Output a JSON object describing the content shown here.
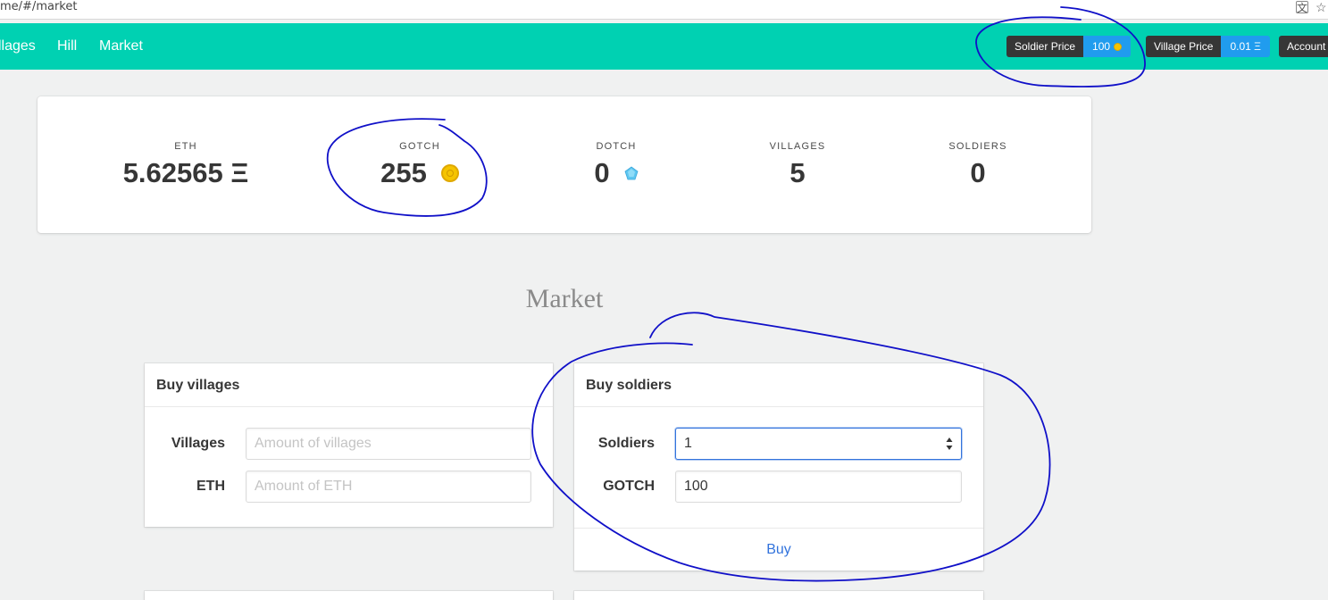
{
  "browser": {
    "url_fragment": "me/#/market"
  },
  "navbar": {
    "links": [
      "llages",
      "Hill",
      "Market"
    ],
    "soldier_price_label": "Soldier Price",
    "soldier_price_value": "100",
    "village_price_label": "Village Price",
    "village_price_value": "0.01 Ξ",
    "account_label": "Account"
  },
  "stats": [
    {
      "heading": "ETH",
      "value": "5.62565 Ξ",
      "icon": ""
    },
    {
      "heading": "GOTCH",
      "value": "255",
      "icon": "gold-coin-icon"
    },
    {
      "heading": "DOTCH",
      "value": "0",
      "icon": "blue-gem-icon"
    },
    {
      "heading": "VILLAGES",
      "value": "5",
      "icon": ""
    },
    {
      "heading": "SOLDIERS",
      "value": "0",
      "icon": ""
    }
  ],
  "market": {
    "title": "Market",
    "buy_villages": {
      "header": "Buy villages",
      "villages_label": "Villages",
      "villages_placeholder": "Amount of villages",
      "eth_label": "ETH",
      "eth_placeholder": "Amount of ETH"
    },
    "buy_soldiers": {
      "header": "Buy soldiers",
      "soldiers_label": "Soldiers",
      "soldiers_value": "1",
      "gotch_label": "GOTCH",
      "gotch_value": "100",
      "buy_label": "Buy"
    }
  },
  "colors": {
    "navbar": "#00d1b2",
    "tag_dark": "#363636",
    "tag_blue": "#209cee",
    "link": "#3273dc",
    "annotation": "#1010c8"
  }
}
